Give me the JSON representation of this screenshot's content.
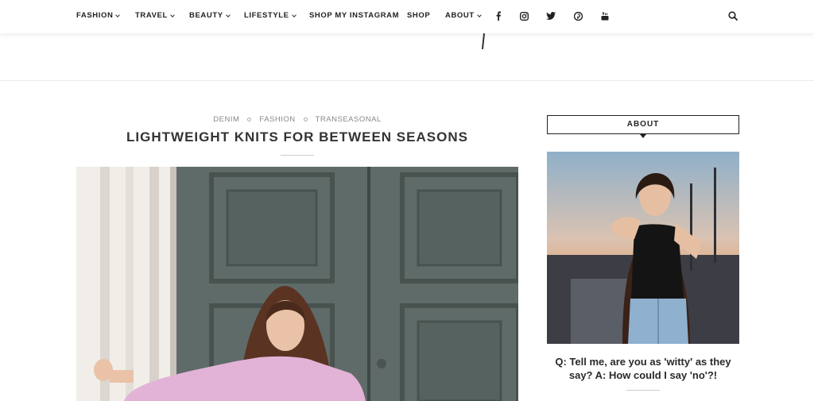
{
  "nav": {
    "items": [
      {
        "label": "FASHION",
        "dropdown": true
      },
      {
        "label": "TRAVEL",
        "dropdown": true
      },
      {
        "label": "BEAUTY",
        "dropdown": true
      },
      {
        "label": "LIFESTYLE",
        "dropdown": true
      },
      {
        "label": "SHOP MY INSTAGRAM",
        "dropdown": false
      },
      {
        "label": "SHOP",
        "dropdown": false
      },
      {
        "label": "ABOUT",
        "dropdown": true
      }
    ],
    "social_icons": [
      "facebook-icon",
      "instagram-icon",
      "twitter-icon",
      "pinterest-icon",
      "youtube-icon"
    ],
    "search_icon": "search-icon"
  },
  "post": {
    "categories": [
      "DENIM",
      "FASHION",
      "TRANSEASONAL"
    ],
    "title": "LIGHTWEIGHT KNITS FOR BETWEEN SEASONS"
  },
  "sidebar": {
    "widget_title": "ABOUT",
    "quote": "Q: Tell me, are you as 'witty' as they say? A: How could I say 'no'?!"
  },
  "colors": {
    "text": "#222222",
    "category_gray": "#888888",
    "door_green": "#5d6966",
    "sweater_pink": "#e2b3d6"
  }
}
